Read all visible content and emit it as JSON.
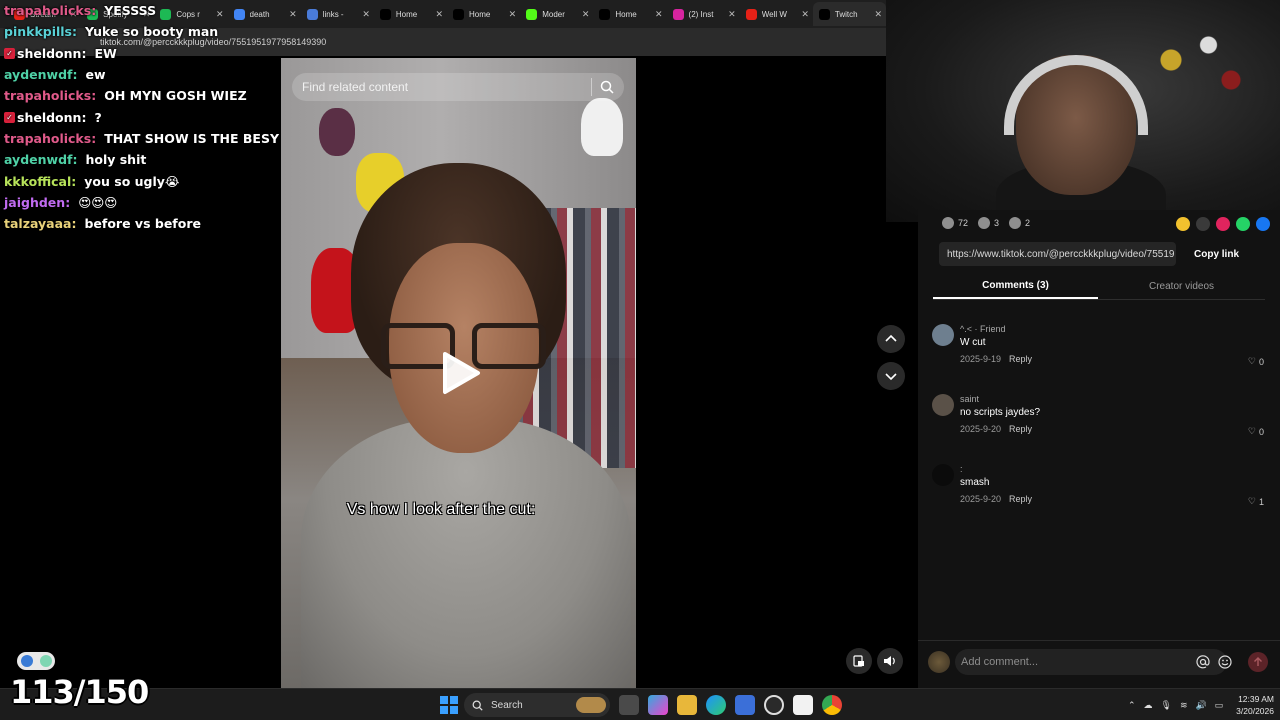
{
  "browser": {
    "tabs": [
      {
        "title": "Stream",
        "icon": "youtube-icon",
        "color": "#e62117"
      },
      {
        "title": "Spotify",
        "icon": "spotify-icon",
        "color": "#1db954"
      },
      {
        "title": "Cops r",
        "icon": "spotify-icon",
        "color": "#1db954"
      },
      {
        "title": "death",
        "icon": "google-icon",
        "color": "#4285f4"
      },
      {
        "title": "links -",
        "icon": "docs-icon",
        "color": "#4a7bd8"
      },
      {
        "title": "Home",
        "icon": "x-icon",
        "color": "#000000"
      },
      {
        "title": "Home",
        "icon": "x-icon",
        "color": "#000000"
      },
      {
        "title": "Moder",
        "icon": "kick-icon",
        "color": "#53fc18"
      },
      {
        "title": "Home",
        "icon": "x-icon",
        "color": "#000000"
      },
      {
        "title": "(2) Inst",
        "icon": "instagram-icon",
        "color": "#d6249f"
      },
      {
        "title": "Well W",
        "icon": "youtube-icon",
        "color": "#e62117"
      },
      {
        "title": "Twitch",
        "icon": "tiktok-icon",
        "color": "#000000"
      }
    ],
    "url": "tiktok.com/@percckkkplug/video/7551951977958149390"
  },
  "chat": [
    {
      "user": "trapaholicks",
      "text": "YESSSS",
      "color": "#e05a8a",
      "badge": false
    },
    {
      "user": "pinkkpills",
      "text": "Yuke so booty man",
      "color": "#5ad1d6",
      "badge": false
    },
    {
      "user": "sheldonn",
      "text": "EW",
      "color": "#ffffff",
      "badge": true
    },
    {
      "user": "aydenwdf",
      "text": "ew",
      "color": "#4fd1a6",
      "badge": false
    },
    {
      "user": "trapaholicks",
      "text": "OH MYN GOSH WIEZ",
      "color": "#e05a8a",
      "badge": false
    },
    {
      "user": "sheldonn",
      "text": "?",
      "color": "#ffffff",
      "badge": true
    },
    {
      "user": "trapaholicks",
      "text": "THAT SHOW IS THE BESY",
      "color": "#e05a8a",
      "badge": false
    },
    {
      "user": "aydenwdf",
      "text": "holy shit",
      "color": "#4fd1a6",
      "badge": false
    },
    {
      "user": "kkkoffical",
      "text": "you so ugly😭",
      "color": "#b7e35a",
      "badge": false
    },
    {
      "user": "jaighden",
      "text": "😍😍😍",
      "color": "#c06bf0",
      "badge": false
    },
    {
      "user": "talzayaaa",
      "text": "before vs before",
      "color": "#e9d27a",
      "badge": false
    }
  ],
  "video": {
    "search_placeholder": "Find related content",
    "caption": "Vs how I look after the cut:"
  },
  "panel": {
    "actions": [
      {
        "icon": "heart-icon",
        "count": "72"
      },
      {
        "icon": "comment-icon",
        "count": "3"
      },
      {
        "icon": "bookmark-icon",
        "count": "2"
      }
    ],
    "share_colors": [
      "#f2c12e",
      "#3a3a3a",
      "#e0245e",
      "#25d366",
      "#1877f2"
    ],
    "link": "https://www.tiktok.com/@percckkkplug/video/75519 51...",
    "copy_label": "Copy link",
    "tabs": [
      "Comments (3)",
      "Creator videos"
    ],
    "comments": [
      {
        "name": "^.< · Friend",
        "text": "W cut",
        "date": "2025-9-19",
        "reply": "Reply",
        "likes": "0"
      },
      {
        "name": "saint",
        "text": "no scripts jaydes?",
        "date": "2025-9-20",
        "reply": "Reply",
        "likes": "0"
      },
      {
        "name": ":",
        "text": "smash",
        "date": "2025-9-20",
        "reply": "Reply",
        "likes": "1"
      }
    ],
    "composer_placeholder": "Add comment..."
  },
  "overlay": {
    "counter": "113/150"
  },
  "taskbar": {
    "search_label": "Search",
    "time": "12:39 AM",
    "date": "3/20/2026"
  }
}
